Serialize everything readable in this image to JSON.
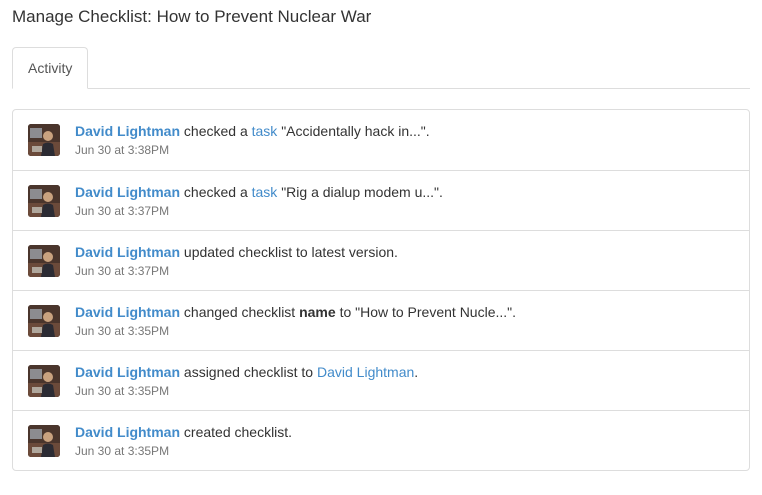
{
  "page": {
    "title": "Manage Checklist: How to Prevent Nuclear War"
  },
  "tabs": [
    {
      "label": "Activity"
    }
  ],
  "activities": [
    {
      "actor": "David Lightman",
      "verb": "checked a",
      "link": "task",
      "detail": "\"Accidentally hack in...\".",
      "time": "Jun 30 at 3:38PM"
    },
    {
      "actor": "David Lightman",
      "verb": "checked a",
      "link": "task",
      "detail": "\"Rig a dialup modem u...\".",
      "time": "Jun 30 at 3:37PM"
    },
    {
      "actor": "David Lightman",
      "verb": "updated checklist to latest version.",
      "time": "Jun 30 at 3:37PM"
    },
    {
      "actor": "David Lightman",
      "verb": "changed checklist",
      "field": "name",
      "detail": "to \"How to Prevent Nucle...\".",
      "time": "Jun 30 at 3:35PM"
    },
    {
      "actor": "David Lightman",
      "verb": "assigned checklist to",
      "link": "David Lightman",
      "detail": ".",
      "time": "Jun 30 at 3:35PM"
    },
    {
      "actor": "David Lightman",
      "verb": "created checklist.",
      "time": "Jun 30 at 3:35PM"
    }
  ],
  "colors": {
    "link": "#428bca",
    "border": "#dddddd",
    "muted": "#777777"
  }
}
